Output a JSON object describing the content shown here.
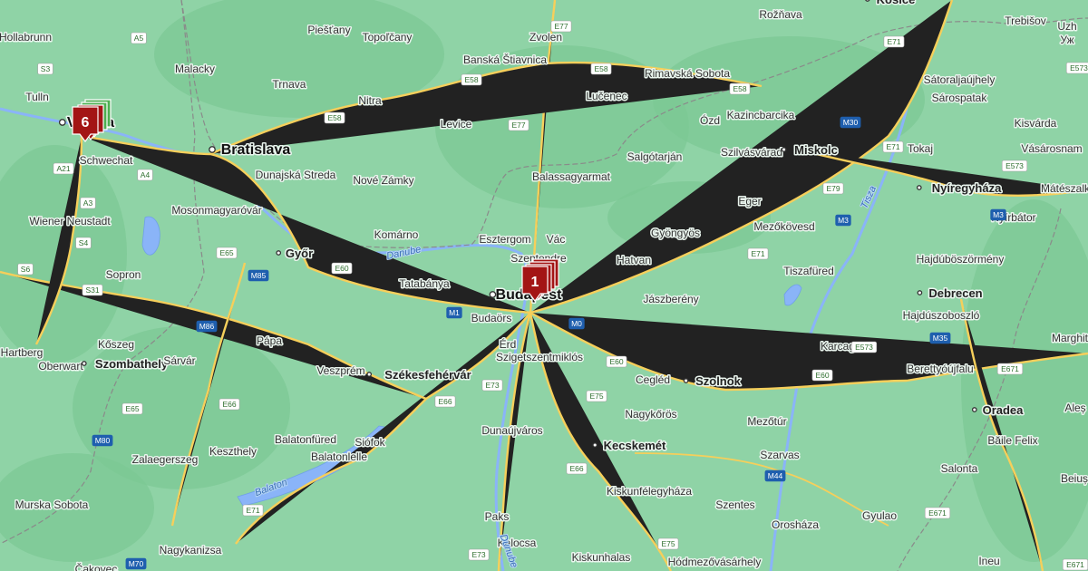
{
  "map": {
    "colors": {
      "land": "#8fd3a6",
      "forest": "#7cc894",
      "water": "#8ab4f8",
      "road": "#f6cf5b",
      "border": "#8a8a8a",
      "marker_red": "#a31515",
      "marker_green": "#4caf50"
    },
    "markers": [
      {
        "id": "budapest-cluster",
        "label": "1",
        "color": "red"
      },
      {
        "id": "vienna-cluster",
        "label": "6",
        "color": "red",
        "stacked": "green"
      }
    ],
    "places": [
      {
        "name": "Hollabrunn",
        "kind": "city"
      },
      {
        "name": "Malacky",
        "kind": "city"
      },
      {
        "name": "Piešťany",
        "kind": "city"
      },
      {
        "name": "Topoľčany",
        "kind": "city"
      },
      {
        "name": "Banská Štiavnica",
        "kind": "city"
      },
      {
        "name": "Zvolen",
        "kind": "city"
      },
      {
        "name": "Rožňava",
        "kind": "city"
      },
      {
        "name": "Košice",
        "kind": "major"
      },
      {
        "name": "Trebišov",
        "kind": "city"
      },
      {
        "name": "Uzh",
        "kind": "city"
      },
      {
        "name": "Уж",
        "kind": "city"
      },
      {
        "name": "Tulln",
        "kind": "city"
      },
      {
        "name": "Trnava",
        "kind": "city"
      },
      {
        "name": "Nitra",
        "kind": "city"
      },
      {
        "name": "Rimavská Sobota",
        "kind": "city"
      },
      {
        "name": "Sátoraljaújhely",
        "kind": "city"
      },
      {
        "name": "Sárospatak",
        "kind": "city"
      },
      {
        "name": "Lučenec",
        "kind": "city"
      },
      {
        "name": "Levice",
        "kind": "city"
      },
      {
        "name": "Ózd",
        "kind": "city"
      },
      {
        "name": "Kazincbarcika",
        "kind": "city"
      },
      {
        "name": "Kisvárda",
        "kind": "city"
      },
      {
        "name": "Bratislava",
        "kind": "capital"
      },
      {
        "name": "Schwechat",
        "kind": "city"
      },
      {
        "name": "Dunajská Streda",
        "kind": "city"
      },
      {
        "name": "Nové Zámky",
        "kind": "city"
      },
      {
        "name": "Salgótarján",
        "kind": "city"
      },
      {
        "name": "Szilvásvárad",
        "kind": "city"
      },
      {
        "name": "Miskolc",
        "kind": "major"
      },
      {
        "name": "Tokaj",
        "kind": "city"
      },
      {
        "name": "Vásárosnam",
        "kind": "city"
      },
      {
        "name": "Balassagyarmat",
        "kind": "city"
      },
      {
        "name": "Nyíregyháza",
        "kind": "major"
      },
      {
        "name": "Mátészalk",
        "kind": "city"
      },
      {
        "name": "Wiener Neustadt",
        "kind": "city"
      },
      {
        "name": "Mosonmagyaróvár",
        "kind": "city"
      },
      {
        "name": "Eger",
        "kind": "city"
      },
      {
        "name": "Nyírbátor",
        "kind": "city"
      },
      {
        "name": "Esztergom",
        "kind": "city"
      },
      {
        "name": "Vác",
        "kind": "city"
      },
      {
        "name": "Gyöngyös",
        "kind": "city"
      },
      {
        "name": "Mezőkövesd",
        "kind": "city"
      },
      {
        "name": "Komárno",
        "kind": "city"
      },
      {
        "name": "Szentendre",
        "kind": "city"
      },
      {
        "name": "Győr",
        "kind": "major"
      },
      {
        "name": "Sopron",
        "kind": "city"
      },
      {
        "name": "Hatvan",
        "kind": "city"
      },
      {
        "name": "Tiszafüred",
        "kind": "city"
      },
      {
        "name": "Hajdúböszörmény",
        "kind": "city"
      },
      {
        "name": "Tatabánya",
        "kind": "city"
      },
      {
        "name": "Budapest",
        "kind": "capital"
      },
      {
        "name": "Jászberény",
        "kind": "city"
      },
      {
        "name": "Debrecen",
        "kind": "major"
      },
      {
        "name": "Budaörs",
        "kind": "city"
      },
      {
        "name": "Hajdúszoboszló",
        "kind": "city"
      },
      {
        "name": "Kőszeg",
        "kind": "city"
      },
      {
        "name": "Pápa",
        "kind": "city"
      },
      {
        "name": "Érd",
        "kind": "city"
      },
      {
        "name": "Karcag",
        "kind": "city"
      },
      {
        "name": "Marghit",
        "kind": "city"
      },
      {
        "name": "Hartberg",
        "kind": "city"
      },
      {
        "name": "Oberwart",
        "kind": "city"
      },
      {
        "name": "Szombathely",
        "kind": "major"
      },
      {
        "name": "Sárvár",
        "kind": "city"
      },
      {
        "name": "Szigetszentmiklós",
        "kind": "city"
      },
      {
        "name": "Berettyóújfalu",
        "kind": "city"
      },
      {
        "name": "Székesfehérvár",
        "kind": "major"
      },
      {
        "name": "Cegléd",
        "kind": "city"
      },
      {
        "name": "Szolnok",
        "kind": "major"
      },
      {
        "name": "Veszprém",
        "kind": "city"
      },
      {
        "name": "Nagykőrös",
        "kind": "city"
      },
      {
        "name": "Mezőtúr",
        "kind": "city"
      },
      {
        "name": "Oradea",
        "kind": "major"
      },
      {
        "name": "Aleș",
        "kind": "city"
      },
      {
        "name": "Balatonfüred",
        "kind": "city"
      },
      {
        "name": "Siófok",
        "kind": "city"
      },
      {
        "name": "Dunaújváros",
        "kind": "city"
      },
      {
        "name": "Kecskemét",
        "kind": "major"
      },
      {
        "name": "Szarvas",
        "kind": "city"
      },
      {
        "name": "Băile Felix",
        "kind": "city"
      },
      {
        "name": "Zalaegerszeg",
        "kind": "city"
      },
      {
        "name": "Keszthely",
        "kind": "city"
      },
      {
        "name": "Balatonlelle",
        "kind": "city"
      },
      {
        "name": "Salonta",
        "kind": "city"
      },
      {
        "name": "Murska Sobota",
        "kind": "city"
      },
      {
        "name": "Kiskunfélegyháza",
        "kind": "city"
      },
      {
        "name": "Szentes",
        "kind": "city"
      },
      {
        "name": "Beiuș",
        "kind": "city"
      },
      {
        "name": "Paks",
        "kind": "city"
      },
      {
        "name": "Orosháza",
        "kind": "city"
      },
      {
        "name": "Gyulao",
        "kind": "city"
      },
      {
        "name": "Nagykanizsa",
        "kind": "city"
      },
      {
        "name": "Kalocsa",
        "kind": "city"
      },
      {
        "name": "Kiskunhalas",
        "kind": "city"
      },
      {
        "name": "Hódmezővásárhely",
        "kind": "city"
      },
      {
        "name": "Ineu",
        "kind": "city"
      },
      {
        "name": "Čakovec",
        "kind": "city"
      },
      {
        "name": "Vienna",
        "kind": "capital"
      }
    ],
    "water_labels": [
      "Danube",
      "Balaton",
      "Tisza",
      "Dunube"
    ],
    "road_shields": [
      {
        "ref": "E77",
        "motorway": false
      },
      {
        "ref": "A5",
        "motorway": false
      },
      {
        "ref": "S3",
        "motorway": false
      },
      {
        "ref": "E58",
        "motorway": false
      },
      {
        "ref": "E58",
        "motorway": false
      },
      {
        "ref": "E58",
        "motorway": false
      },
      {
        "ref": "E71",
        "motorway": false
      },
      {
        "ref": "E573",
        "motorway": false
      },
      {
        "ref": "E58",
        "motorway": false
      },
      {
        "ref": "E77",
        "motorway": false
      },
      {
        "ref": "M30",
        "motorway": true
      },
      {
        "ref": "E71",
        "motorway": false
      },
      {
        "ref": "A21",
        "motorway": false
      },
      {
        "ref": "A4",
        "motorway": false
      },
      {
        "ref": "E573",
        "motorway": false
      },
      {
        "ref": "A3",
        "motorway": false
      },
      {
        "ref": "E79",
        "motorway": false
      },
      {
        "ref": "M3",
        "motorway": true
      },
      {
        "ref": "M3",
        "motorway": true
      },
      {
        "ref": "S4",
        "motorway": false
      },
      {
        "ref": "E65",
        "motorway": false
      },
      {
        "ref": "E60",
        "motorway": false
      },
      {
        "ref": "E71",
        "motorway": false
      },
      {
        "ref": "S6",
        "motorway": false
      },
      {
        "ref": "M85",
        "motorway": true
      },
      {
        "ref": "S31",
        "motorway": false
      },
      {
        "ref": "M1",
        "motorway": true
      },
      {
        "ref": "M0",
        "motorway": true
      },
      {
        "ref": "M86",
        "motorway": true
      },
      {
        "ref": "E60",
        "motorway": false
      },
      {
        "ref": "E573",
        "motorway": false
      },
      {
        "ref": "M35",
        "motorway": true
      },
      {
        "ref": "E66",
        "motorway": false
      },
      {
        "ref": "E73",
        "motorway": false
      },
      {
        "ref": "E75",
        "motorway": false
      },
      {
        "ref": "E60",
        "motorway": false
      },
      {
        "ref": "E671",
        "motorway": false
      },
      {
        "ref": "E65",
        "motorway": false
      },
      {
        "ref": "E66",
        "motorway": false
      },
      {
        "ref": "M80",
        "motorway": true
      },
      {
        "ref": "E66",
        "motorway": false
      },
      {
        "ref": "M44",
        "motorway": true
      },
      {
        "ref": "E71",
        "motorway": false
      },
      {
        "ref": "E73",
        "motorway": false
      },
      {
        "ref": "E75",
        "motorway": false
      },
      {
        "ref": "E671",
        "motorway": false
      },
      {
        "ref": "M70",
        "motorway": true
      },
      {
        "ref": "E671",
        "motorway": false
      }
    ]
  }
}
